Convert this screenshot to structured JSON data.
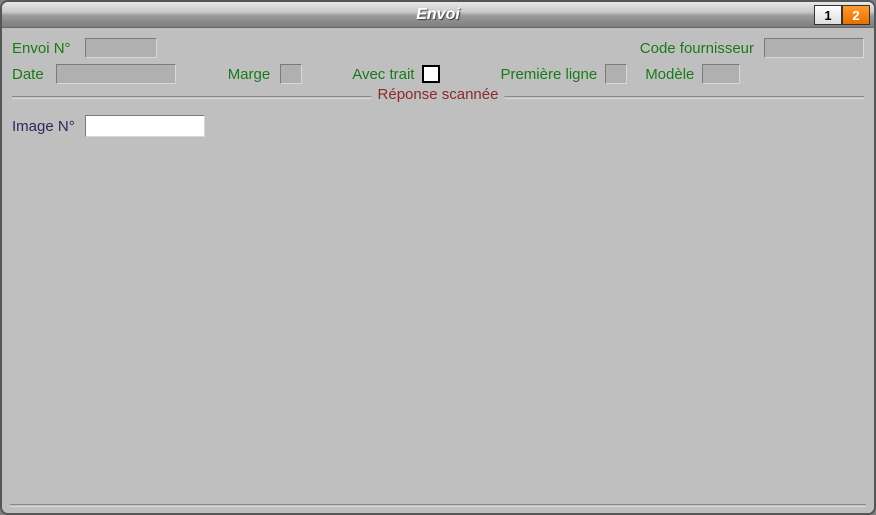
{
  "window": {
    "title": "Envoi"
  },
  "tabs": {
    "tab1": "1",
    "tab2": "2"
  },
  "fields": {
    "envoi_label": "Envoi N°",
    "envoi_value": "",
    "code_fournisseur_label": "Code fournisseur",
    "code_fournisseur_value": "",
    "date_label": "Date",
    "date_value": "",
    "marge_label": "Marge",
    "marge_value": "",
    "avec_trait_label": "Avec trait",
    "premiere_ligne_label": "Première ligne",
    "premiere_ligne_value": "",
    "modele_label": "Modèle",
    "modele_value": "",
    "section_legend": "Réponse scannée",
    "image_label": "Image N°",
    "image_value": ""
  }
}
